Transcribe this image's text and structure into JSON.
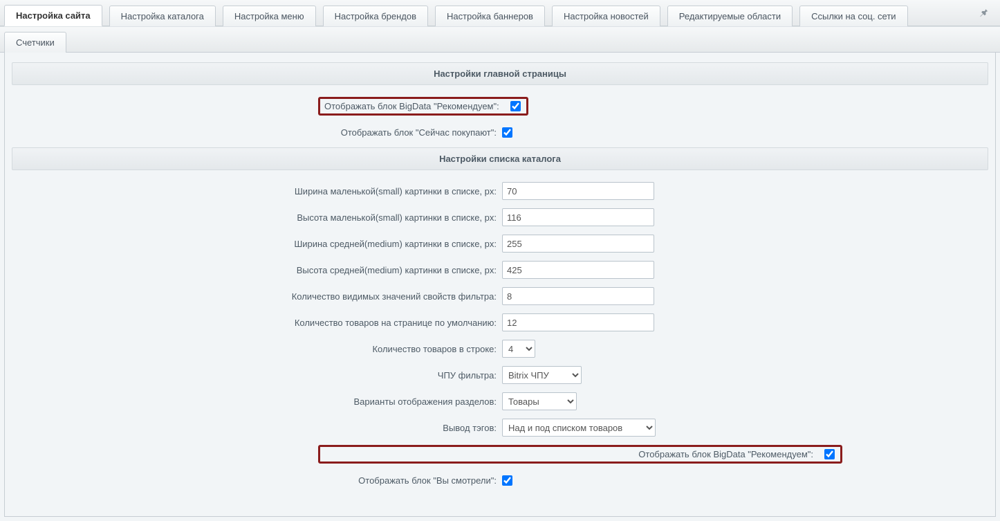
{
  "tabs_top": [
    {
      "label": "Настройка сайта",
      "active": true
    },
    {
      "label": "Настройка каталога",
      "active": false
    },
    {
      "label": "Настройка меню",
      "active": false
    },
    {
      "label": "Настройка брендов",
      "active": false
    },
    {
      "label": "Настройка баннеров",
      "active": false
    },
    {
      "label": "Настройка новостей",
      "active": false
    },
    {
      "label": "Редактируемые области",
      "active": false
    },
    {
      "label": "Ссылки на соц. сети",
      "active": false
    }
  ],
  "tabs_second": [
    {
      "label": "Счетчики",
      "active": false
    }
  ],
  "sections": {
    "main_page": {
      "title": "Настройки главной страницы",
      "bigdata_recommend_label": "Отображать блок BigData \"Рекомендуем\":",
      "bigdata_recommend_checked": true,
      "now_buying_label": "Отображать блок \"Сейчас покупают\":",
      "now_buying_checked": true
    },
    "catalog_list": {
      "title": "Настройки списка каталога",
      "small_width_label": "Ширина маленькой(small) картинки в списке, px:",
      "small_width_value": "70",
      "small_height_label": "Высота маленькой(small) картинки в списке, px:",
      "small_height_value": "116",
      "medium_width_label": "Ширина средней(medium) картинки в списке, px:",
      "medium_width_value": "255",
      "medium_height_label": "Высота средней(medium) картинки в списке, px:",
      "medium_height_value": "425",
      "filter_visible_label": "Количество видимых значений свойств фильтра:",
      "filter_visible_value": "8",
      "per_page_label": "Количество товаров на странице по умолчанию:",
      "per_page_value": "12",
      "per_row_label": "Количество товаров в строке:",
      "per_row_value": "4",
      "sef_label": "ЧПУ фильтра:",
      "sef_value": "Bitrix ЧПУ",
      "sections_view_label": "Варианты отображения разделов:",
      "sections_view_value": "Товары",
      "tags_output_label": "Вывод тэгов:",
      "tags_output_value": "Над и под списком товаров",
      "bigdata_recommend_label": "Отображать блок BigData \"Рекомендуем\":",
      "bigdata_recommend_checked": true,
      "viewed_label": "Отображать блок \"Вы смотрели\":",
      "viewed_checked": true
    }
  }
}
